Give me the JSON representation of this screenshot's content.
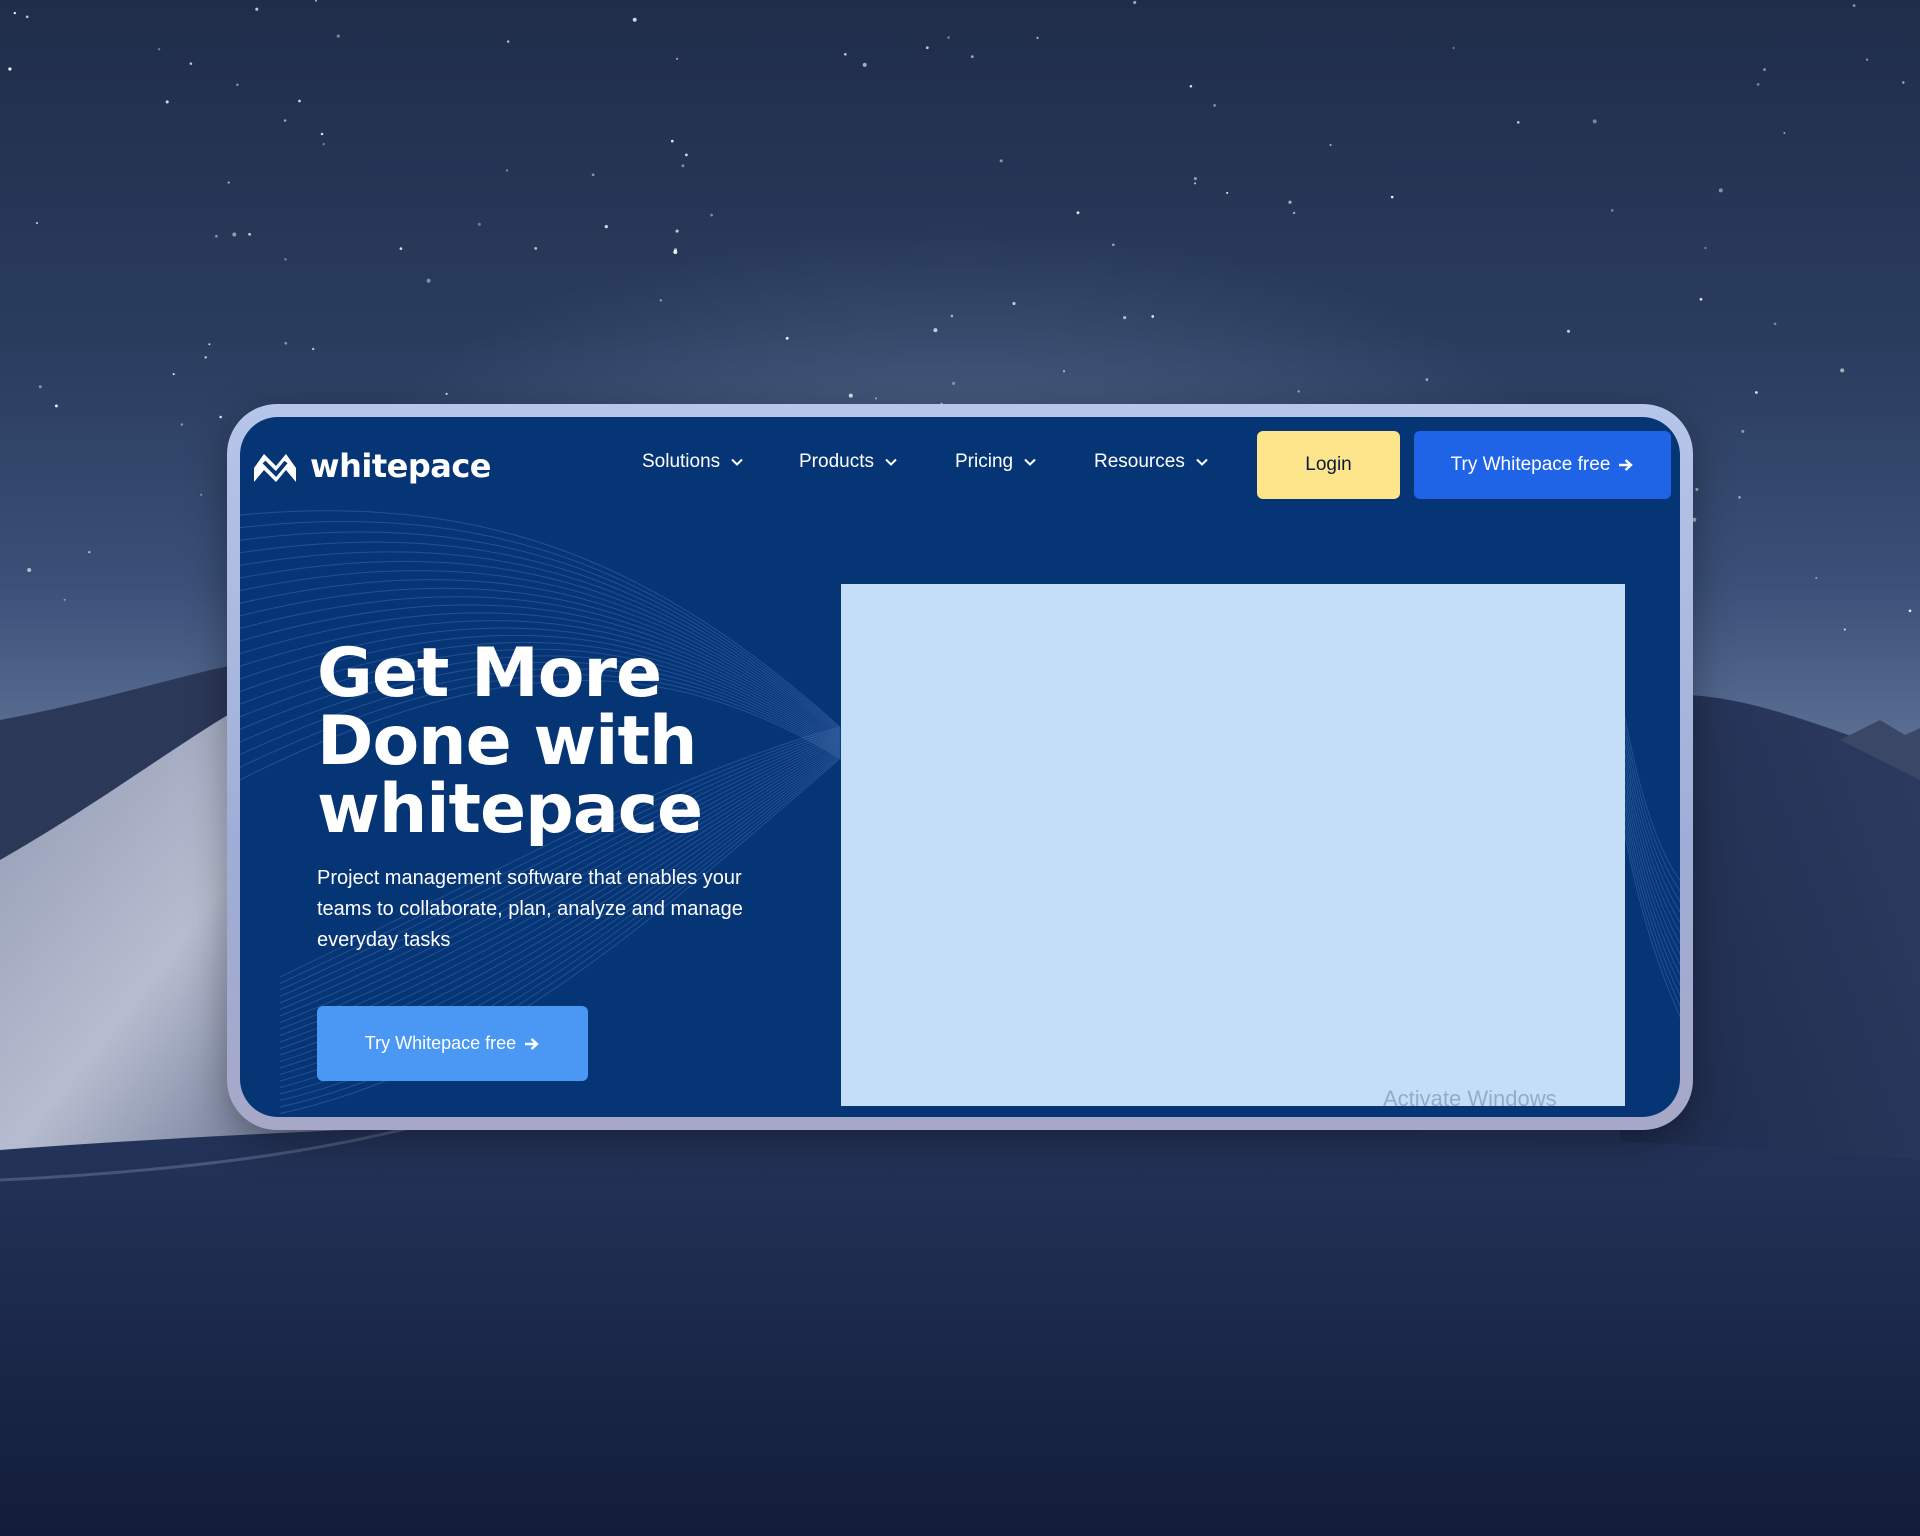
{
  "brand": {
    "name": "whitepace",
    "logo_icon": "whitepace-logo-icon"
  },
  "nav": {
    "items": [
      {
        "label": "Solutions",
        "icon": "chevron-down-icon"
      },
      {
        "label": "Products",
        "icon": "chevron-down-icon"
      },
      {
        "label": "Pricing",
        "icon": "chevron-down-icon"
      },
      {
        "label": "Resources",
        "icon": "chevron-down-icon"
      }
    ],
    "login_label": "Login",
    "try_label": "Try Whitepace free",
    "try_icon": "arrow-right-icon"
  },
  "hero": {
    "title_lines": [
      "Get More",
      "Done with",
      "whitepace"
    ],
    "subtitle": "Project management software that enables your teams to collaborate, plan, analyze and manage everyday tasks",
    "cta_label": "Try Whitepace free",
    "cta_icon": "arrow-right-icon"
  },
  "system": {
    "watermark": "Activate Windows"
  },
  "colors": {
    "page_background": "#063576",
    "login_button": "#fde58c",
    "nav_cta": "#1f63e6",
    "hero_cta": "#4a98f4",
    "media_panel": "#c4def9"
  }
}
